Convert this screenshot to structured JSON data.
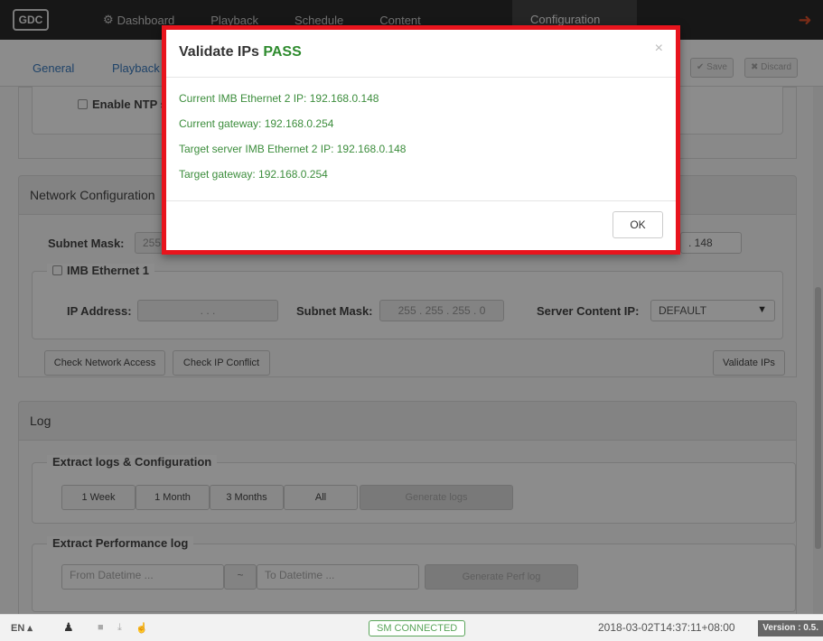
{
  "topnav": {
    "logo": "GDC",
    "items": [
      "Dashboard",
      "Playback",
      "Schedule",
      "Content",
      "Configuration"
    ]
  },
  "subnav": {
    "tabs": [
      "General",
      "Playback"
    ],
    "save": "✔ Save",
    "discard": "✖ Discard"
  },
  "ntp": {
    "label": "Enable NTP server"
  },
  "network": {
    "heading": "Network Configuration",
    "subnet_label": "Subnet Mask:",
    "subnet_partial": "255",
    "right_ip_partial": ". 148",
    "imb1": {
      "legend": "IMB Ethernet 1",
      "ip_label": "IP Address:",
      "ip_value": ". . .",
      "subnet_label": "Subnet Mask:",
      "subnet_value": "255 . 255 . 255 . 0",
      "server_label": "Server Content IP:",
      "server_value": "DEFAULT"
    },
    "buttons": {
      "check_network": "Check Network Access",
      "check_conflict": "Check IP Conflict",
      "validate": "Validate IPs"
    }
  },
  "log": {
    "heading": "Log",
    "extract_legend": "Extract logs & Configuration",
    "ranges": [
      "1 Week",
      "1 Month",
      "3 Months",
      "All"
    ],
    "generate_logs": "Generate logs",
    "perf_legend": "Extract Performance log",
    "from_placeholder": "From Datetime ...",
    "separator": "~",
    "to_placeholder": "To Datetime ...",
    "generate_perf": "Generate Perf log"
  },
  "modal": {
    "title": "Validate IPs",
    "status": "PASS",
    "close": "×",
    "lines": [
      "Current IMB Ethernet 2 IP: 192.168.0.148",
      "Current gateway: 192.168.0.254",
      "Target server IMB Ethernet 2 IP: 192.168.0.148",
      "Target gateway: 192.168.0.254"
    ],
    "ok": "OK"
  },
  "status": {
    "lang": "EN ▴",
    "sm": "SM CONNECTED",
    "datetime": "2018-03-02T14:37:11+08:00",
    "version": "Version : 0.5."
  },
  "colors": {
    "pass": "#2e8b2e",
    "highlight": "#e8141d",
    "logout": "#e0502b"
  }
}
